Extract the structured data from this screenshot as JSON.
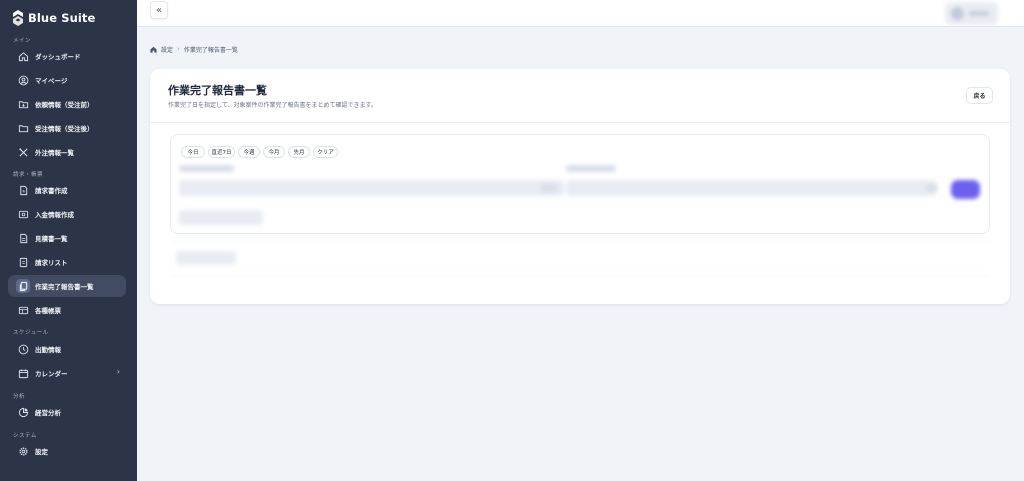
{
  "sidebar": {
    "brand": "Blue Suite",
    "sections": {
      "main": "メイン",
      "billing": "請求・帳票",
      "schedule": "スケジュール",
      "analysis": "分析",
      "system": "システム"
    },
    "items": [
      {
        "label": "ダッシュボード",
        "icon": "home-icon"
      },
      {
        "label": "マイページ",
        "icon": "user-circle-icon"
      },
      {
        "label": "依頼情報（受注前）",
        "icon": "folder-in-icon"
      },
      {
        "label": "受注情報（受注後）",
        "icon": "folder-icon"
      },
      {
        "label": "外注情報一覧",
        "icon": "tools-icon"
      },
      {
        "label": "請求書作成",
        "icon": "invoice-icon"
      },
      {
        "label": "入金情報作成",
        "icon": "payment-icon"
      },
      {
        "label": "見積書一覧",
        "icon": "document-icon"
      },
      {
        "label": "請求リスト",
        "icon": "list-icon"
      },
      {
        "label": "作業完了報告書一覧",
        "icon": "report-copy-icon"
      },
      {
        "label": "各種帳票",
        "icon": "table-icon"
      },
      {
        "label": "出勤情報",
        "icon": "clock-icon"
      },
      {
        "label": "カレンダー",
        "icon": "calendar-icon"
      },
      {
        "label": "経営分析",
        "icon": "pie-chart-icon"
      },
      {
        "label": "設定",
        "icon": "gear-icon"
      }
    ],
    "active_index": 9
  },
  "topbar": {
    "collapse_icon": "double-chevron-left-icon",
    "collapse_glyph": "«"
  },
  "breadcrumb": {
    "home_icon": "home-icon",
    "parent": "設定",
    "current": "作業完了報告書一覧"
  },
  "page": {
    "title": "作業完了報告書一覧",
    "subtitle": "作業完了日を指定して、対象案件の作業完了報告書をまとめて確認できます。",
    "back_label": "戻る"
  },
  "filters": {
    "quick_ranges": [
      "今日",
      "直近7日",
      "今週",
      "今月",
      "先月",
      "クリア"
    ]
  },
  "colors": {
    "sidebar_bg": "#2c3547",
    "active_item_bg": "#414c63",
    "page_bg": "#f0f3f8",
    "primary_button": "#6d5ff0"
  }
}
